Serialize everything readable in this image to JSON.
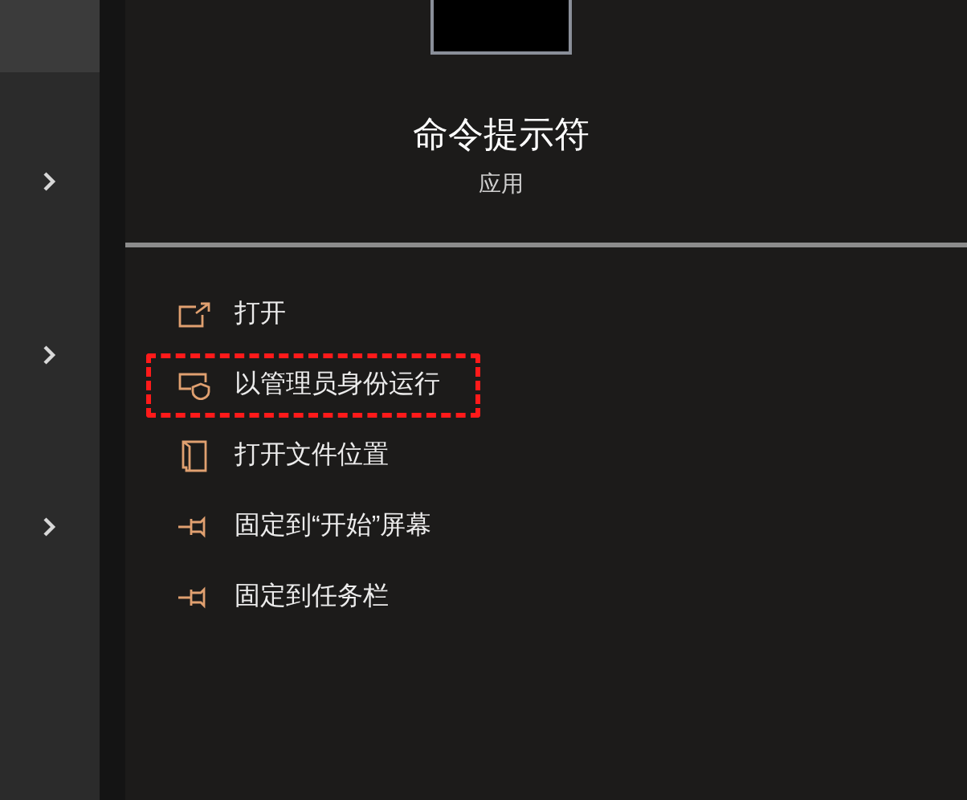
{
  "app": {
    "name": "命令提示符",
    "type": "应用"
  },
  "menu": [
    {
      "kind": "open",
      "label": "打开",
      "highlighted": false
    },
    {
      "kind": "admin",
      "label": "以管理员身份运行",
      "highlighted": true
    },
    {
      "kind": "folder",
      "label": "打开文件位置",
      "highlighted": false
    },
    {
      "kind": "pin",
      "label": "固定到“开始”屏幕",
      "highlighted": false
    },
    {
      "kind": "pin",
      "label": "固定到任务栏",
      "highlighted": false
    }
  ]
}
